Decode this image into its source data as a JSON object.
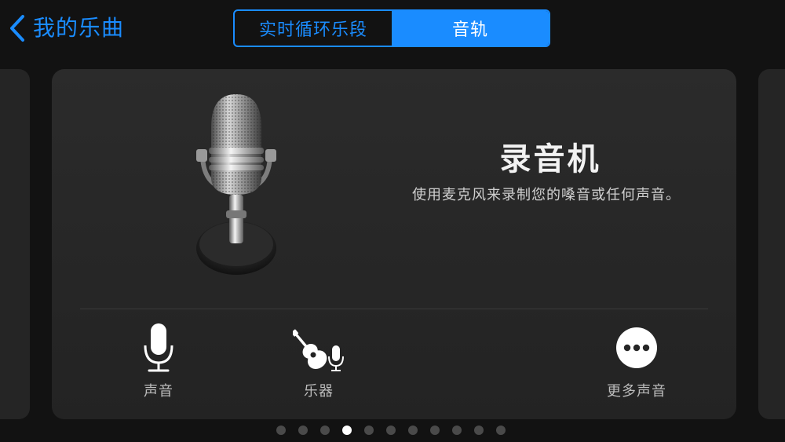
{
  "nav": {
    "back_label": "我的乐曲"
  },
  "segments": [
    {
      "label": "实时循环乐段",
      "selected": false
    },
    {
      "label": "音轨",
      "selected": true
    }
  ],
  "card": {
    "title": "录音机",
    "description": "使用麦克风来录制您的嗓音或任何声音。",
    "options": [
      {
        "label": "声音",
        "icon": "microphone-icon"
      },
      {
        "label": "乐器",
        "icon": "guitar-with-mic-icon"
      },
      {
        "label": "更多声音",
        "icon": "more-icon"
      }
    ]
  },
  "pagination": {
    "total": 11,
    "current": 4
  },
  "colors": {
    "accent": "#1a8cff",
    "background": "#121212",
    "card": "#262626"
  }
}
